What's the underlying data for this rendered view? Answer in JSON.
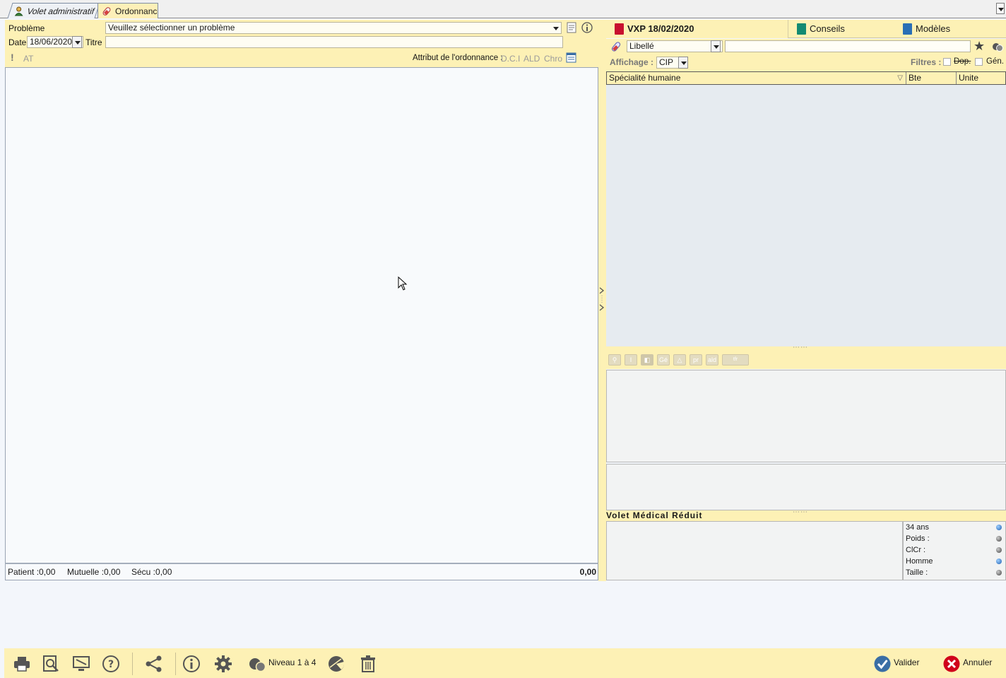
{
  "tabs": {
    "admin": "Volet administratif",
    "ordonnance": "Ordonnance"
  },
  "form": {
    "probleme_label": "Problème",
    "probleme_value": "Veuillez sélectionner un problème",
    "date_label": "Date",
    "date_value": "18/06/2020",
    "titre_label": "Titre",
    "titre_value": "",
    "at_label": "AT",
    "attribut_label": "Attribut de l'ordonnance :",
    "attributs": [
      "D.C.I",
      "ALD",
      "Chro"
    ]
  },
  "totals": {
    "patient": "Patient :0,00",
    "mutuelle": "Mutuelle :0,00",
    "secu": "Sécu :0,00",
    "total": "0,00"
  },
  "right_tabs": {
    "vxp": "VXP 18/02/2020",
    "conseils": "Conseils",
    "modeles": "Modèles"
  },
  "search": {
    "mode": "Libellé",
    "query": "",
    "affichage_label": "Affichage :",
    "affichage_value": "CIP",
    "filtres_label": "Filtres :",
    "filtre_dop": "Dop.",
    "filtre_gen": "Gén."
  },
  "grid": {
    "columns": [
      "Spécialité humaine",
      "Bte",
      "Unite"
    ]
  },
  "icon_toolbar": [
    "Gé",
    "pr",
    "ald",
    "tfr"
  ],
  "vmr": {
    "title": "Volet Médical Réduit",
    "age": "34 ans",
    "poids": "Poids :",
    "clcr": "ClCr :",
    "sexe": "Homme",
    "taille": "Taille :"
  },
  "bottom": {
    "niveau": "Niveau 1 à 4",
    "valider": "Valider",
    "annuler": "Annuler"
  },
  "colors": {
    "panel_yellow": "#fdf1b5",
    "red_book": "#c8102e",
    "green_book": "#138a72",
    "blue_book": "#2a6fb5",
    "annuler_red": "#d0021b",
    "valider_blue": "#3a6ea5"
  }
}
